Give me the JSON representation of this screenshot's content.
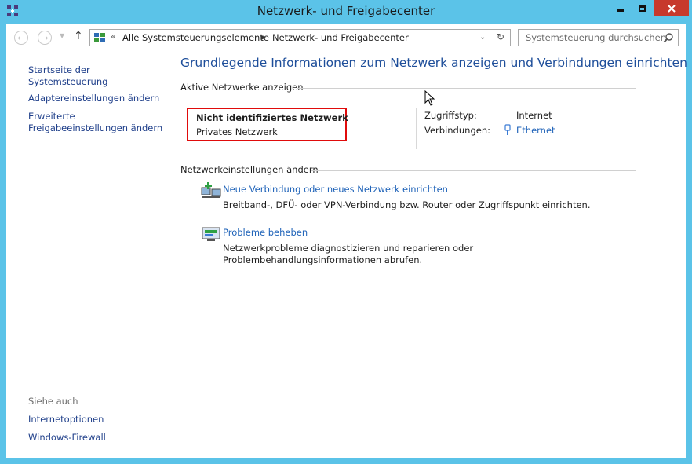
{
  "window": {
    "title": "Netzwerk- und Freigabecenter",
    "accent": "#5bc3e8",
    "close_color": "#c7392c"
  },
  "toolbar": {
    "breadcrumb_overflow": "«",
    "crumb1": "Alle Systemsteuerungselemente",
    "crumb2": "Netzwerk- und Freigabecenter",
    "search_placeholder": "Systemsteuerung durchsuchen"
  },
  "sidebar": {
    "home": "Startseite der Systemsteuerung",
    "adapter": "Adaptereinstellungen ändern",
    "advanced_line1": "Erweiterte",
    "advanced_line2": "Freigabeeinstellungen ändern",
    "see_also_heading": "Siehe auch",
    "internet_options": "Internetoptionen",
    "firewall": "Windows-Firewall"
  },
  "main": {
    "heading": "Grundlegende Informationen zum Netzwerk anzeigen und Verbindungen einrichten",
    "active_networks_label": "Aktive Netzwerke anzeigen",
    "network": {
      "name": "Nicht identifiziertes Netzwerk",
      "category": "Privates Netzwerk",
      "access_type_label": "Zugriffstyp:",
      "access_type_value": "Internet",
      "connections_label": "Verbindungen:",
      "connections_value": "Ethernet"
    },
    "change_settings_label": "Netzwerkeinstellungen ändern",
    "tasks": [
      {
        "link": "Neue Verbindung oder neues Netzwerk einrichten",
        "description": "Breitband-, DFÜ- oder VPN-Verbindung bzw. Router oder Zugriffspunkt einrichten."
      },
      {
        "link": "Probleme beheben",
        "description": "Netzwerkprobleme diagnostizieren und reparieren oder Problembehandlungsinformationen abrufen."
      }
    ]
  },
  "icons": {
    "app": "network-center-icon",
    "back": "back-arrow-icon",
    "forward": "forward-arrow-icon",
    "up": "up-arrow-icon",
    "refresh": "refresh-icon",
    "search": "search-icon",
    "ethernet": "ethernet-icon",
    "new_connection": "new-connection-icon",
    "troubleshoot": "troubleshoot-icon"
  }
}
